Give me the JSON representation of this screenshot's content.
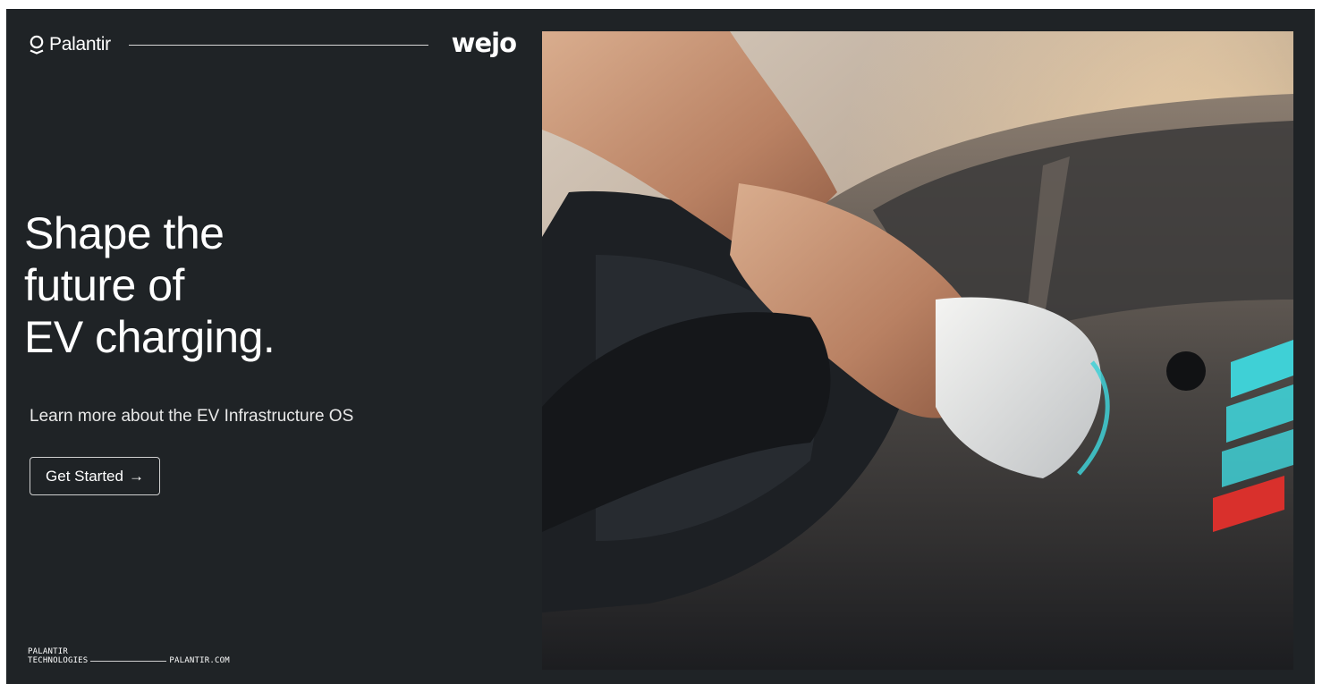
{
  "brand": {
    "palantir_logo_text": "Palantir",
    "partner_logo_text": "wejo"
  },
  "hero": {
    "headline_lines": [
      "Shape the",
      "future of",
      "EV charging."
    ],
    "subheading": "Learn more about the EV Infrastructure OS",
    "cta_label": "Get Started",
    "cta_arrow": "→"
  },
  "footer": {
    "company_lines": [
      "PALANTIR",
      "TECHNOLOGIES"
    ],
    "url": "PALANTIR.COM"
  },
  "image": {
    "subject": "hand-plugging-ev-charger-icon"
  },
  "colors": {
    "background": "#1f2326",
    "text": "#ffffff",
    "charge_indicator_teal": "#3fd0d6",
    "charge_indicator_red": "#d9302c"
  }
}
